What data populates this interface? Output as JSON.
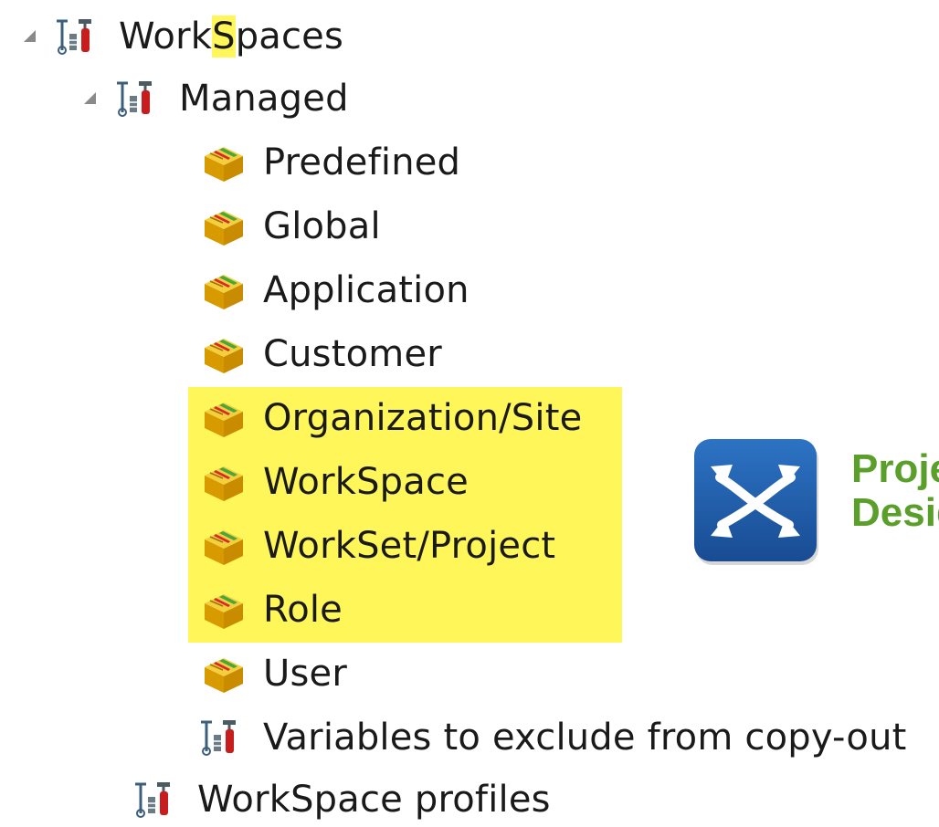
{
  "tree": {
    "root": {
      "label_before": "Work",
      "label_highlight": "S",
      "label_after": "paces",
      "expanded": true
    },
    "managed": {
      "label": "Managed",
      "expanded": true
    },
    "managed_items": [
      {
        "label": "Predefined"
      },
      {
        "label": "Global"
      },
      {
        "label": "Application"
      },
      {
        "label": "Customer"
      },
      {
        "label": "Organization/Site"
      },
      {
        "label": "WorkSpace"
      },
      {
        "label": "WorkSet/Project"
      },
      {
        "label": "Role"
      },
      {
        "label": "User"
      }
    ],
    "exclude_item": {
      "label": "Variables to exclude from copy-out"
    },
    "profiles_item": {
      "label": "WorkSpace profiles"
    }
  },
  "brand": {
    "line1": "Proje",
    "line2": "Desig"
  },
  "colors": {
    "highlight": "#fff65a",
    "brand_green": "#5a9f2a",
    "logo_blue": "#1f5aa8",
    "box_yellow": "#e7b800",
    "tool_red": "#c81d1d"
  },
  "icons": {
    "root": "config-tools-icon",
    "managed": "config-tools-icon",
    "item": "package-box-icon",
    "exclude_item": "config-tools-icon",
    "profiles_item": "config-tools-icon",
    "logo": "project-design-logo-icon"
  }
}
